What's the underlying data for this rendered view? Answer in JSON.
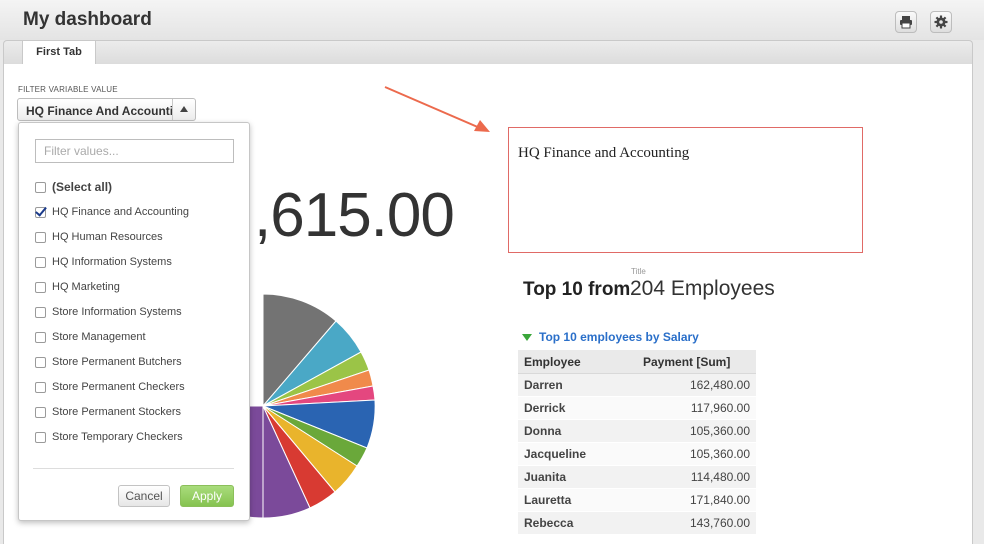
{
  "header": {
    "title": "My dashboard",
    "print_icon": "printer-icon",
    "settings_icon": "gear-icon"
  },
  "tabs": [
    {
      "label": "First Tab"
    }
  ],
  "filter": {
    "label": "FILTER VARIABLE VALUE",
    "selected": "HQ Finance And Accounting",
    "search_placeholder": "Filter values...",
    "options": [
      {
        "label": "(Select all)",
        "checked": false
      },
      {
        "label": "HQ Finance and Accounting",
        "checked": true
      },
      {
        "label": "HQ Human Resources",
        "checked": false
      },
      {
        "label": "HQ Information Systems",
        "checked": false
      },
      {
        "label": "HQ Marketing",
        "checked": false
      },
      {
        "label": "Store Information Systems",
        "checked": false
      },
      {
        "label": "Store Management",
        "checked": false
      },
      {
        "label": "Store Permanent Butchers",
        "checked": false
      },
      {
        "label": "Store Permanent Checkers",
        "checked": false
      },
      {
        "label": "Store Permanent Stockers",
        "checked": false
      },
      {
        "label": "Store Temporary Checkers",
        "checked": false
      }
    ],
    "cancel_label": "Cancel",
    "apply_label": "Apply"
  },
  "big_number": ",615.00",
  "textbox": "HQ Finance and Accounting",
  "kpi": {
    "small_title": "Title",
    "left_text": "Top 10 from",
    "right_text": "204 Employees"
  },
  "table": {
    "title": "Top 10 employees by Salary",
    "columns": [
      "Employee",
      "Payment [Sum]"
    ],
    "rows": [
      [
        "Darren",
        "162,480.00"
      ],
      [
        "Derrick",
        "117,960.00"
      ],
      [
        "Donna",
        "105,360.00"
      ],
      [
        "Jacqueline",
        "105,360.00"
      ],
      [
        "Juanita",
        "114,480.00"
      ],
      [
        "Lauretta",
        "171,840.00"
      ],
      [
        "Rebecca",
        "143,760.00"
      ]
    ]
  },
  "colors": {
    "accent_link": "#2a6fc9",
    "apply_green": "#86c350",
    "annotation_red": "#e06a66"
  }
}
